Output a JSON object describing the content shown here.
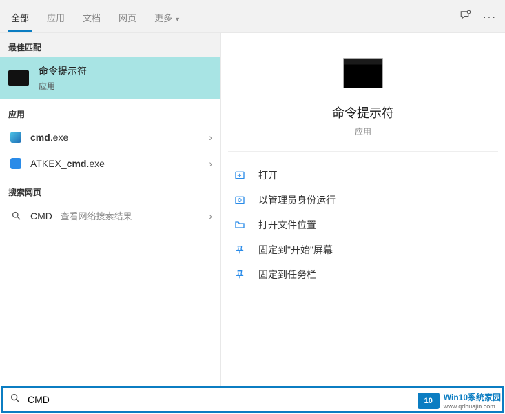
{
  "header": {
    "tabs": [
      "全部",
      "应用",
      "文档",
      "网页",
      "更多"
    ],
    "feedback_icon": "feedback",
    "more_icon": "ellipsis"
  },
  "left": {
    "best_match_header": "最佳匹配",
    "best_match": {
      "title": "命令提示符",
      "subtitle": "应用"
    },
    "apps_header": "应用",
    "apps": [
      {
        "label_before": "",
        "label_bold": "cmd",
        "label_after": ".exe",
        "icon": "win"
      },
      {
        "label_before": "ATKEX_",
        "label_bold": "cmd",
        "label_after": ".exe",
        "icon": "blue"
      }
    ],
    "web_header": "搜索网页",
    "web": {
      "prefix": "CMD",
      "suffix": " - 查看网络搜索结果"
    }
  },
  "right": {
    "title": "命令提示符",
    "subtitle": "应用",
    "actions": [
      {
        "icon": "open",
        "label": "打开"
      },
      {
        "icon": "admin",
        "label": "以管理员身份运行"
      },
      {
        "icon": "folder",
        "label": "打开文件位置"
      },
      {
        "icon": "pin-start",
        "label": "固定到\"开始\"屏幕"
      },
      {
        "icon": "pin-taskbar",
        "label": "固定到任务栏"
      }
    ]
  },
  "search": {
    "value": "CMD"
  },
  "watermark": {
    "logo": "10",
    "line1": "Win10系统家园",
    "line2": "www.qdhuajin.com"
  }
}
